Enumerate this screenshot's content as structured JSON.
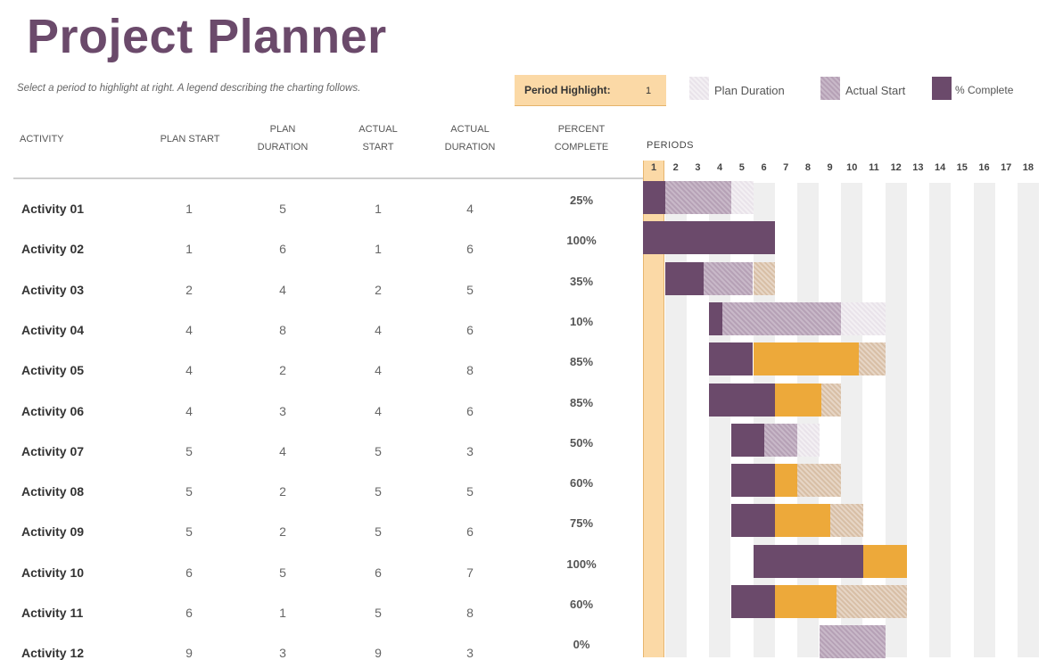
{
  "title": "Project Planner",
  "instructions": "Select a period to highlight at right.  A legend describing the charting follows.",
  "period_highlight": {
    "label": "Period Highlight:",
    "value": "1"
  },
  "legend": [
    {
      "label": "Plan Duration",
      "color": "#e9e3ea"
    },
    {
      "label": "Actual Start",
      "color": "#b6a1b6"
    },
    {
      "label": "% Complete",
      "color": "#6b4a6b"
    }
  ],
  "colors": {
    "beyond_plan": "#eda93a",
    "highlight": "#fbd9a6"
  },
  "columns": {
    "activity": "ACTIVITY",
    "plan_start": "PLAN START",
    "plan_duration": "PLAN\nDURATION",
    "actual_start": "ACTUAL\nSTART",
    "actual_duration": "ACTUAL\nDURATION",
    "percent_complete": "PERCENT\nCOMPLETE"
  },
  "periods_label": "PERIODS",
  "periods": [
    "1",
    "2",
    "3",
    "4",
    "5",
    "6",
    "7",
    "8",
    "9",
    "10",
    "11",
    "12",
    "13",
    "14",
    "15",
    "16",
    "17",
    "18"
  ],
  "activities": [
    {
      "name": "Activity 01",
      "plan_start": "1",
      "plan_duration": "5",
      "actual_start": "1",
      "actual_duration": "4",
      "percent": "25%"
    },
    {
      "name": "Activity 02",
      "plan_start": "1",
      "plan_duration": "6",
      "actual_start": "1",
      "actual_duration": "6",
      "percent": "100%"
    },
    {
      "name": "Activity 03",
      "plan_start": "2",
      "plan_duration": "4",
      "actual_start": "2",
      "actual_duration": "5",
      "percent": "35%"
    },
    {
      "name": "Activity 04",
      "plan_start": "4",
      "plan_duration": "8",
      "actual_start": "4",
      "actual_duration": "6",
      "percent": "10%"
    },
    {
      "name": "Activity 05",
      "plan_start": "4",
      "plan_duration": "2",
      "actual_start": "4",
      "actual_duration": "8",
      "percent": "85%"
    },
    {
      "name": "Activity 06",
      "plan_start": "4",
      "plan_duration": "3",
      "actual_start": "4",
      "actual_duration": "6",
      "percent": "85%"
    },
    {
      "name": "Activity 07",
      "plan_start": "5",
      "plan_duration": "4",
      "actual_start": "5",
      "actual_duration": "3",
      "percent": "50%"
    },
    {
      "name": "Activity 08",
      "plan_start": "5",
      "plan_duration": "2",
      "actual_start": "5",
      "actual_duration": "5",
      "percent": "60%"
    },
    {
      "name": "Activity 09",
      "plan_start": "5",
      "plan_duration": "2",
      "actual_start": "5",
      "actual_duration": "6",
      "percent": "75%"
    },
    {
      "name": "Activity 10",
      "plan_start": "6",
      "plan_duration": "5",
      "actual_start": "6",
      "actual_duration": "7",
      "percent": "100%"
    },
    {
      "name": "Activity 11",
      "plan_start": "6",
      "plan_duration": "1",
      "actual_start": "5",
      "actual_duration": "8",
      "percent": "60%"
    },
    {
      "name": "Activity 12",
      "plan_start": "9",
      "plan_duration": "3",
      "actual_start": "9",
      "actual_duration": "3",
      "percent": "0%"
    }
  ]
}
